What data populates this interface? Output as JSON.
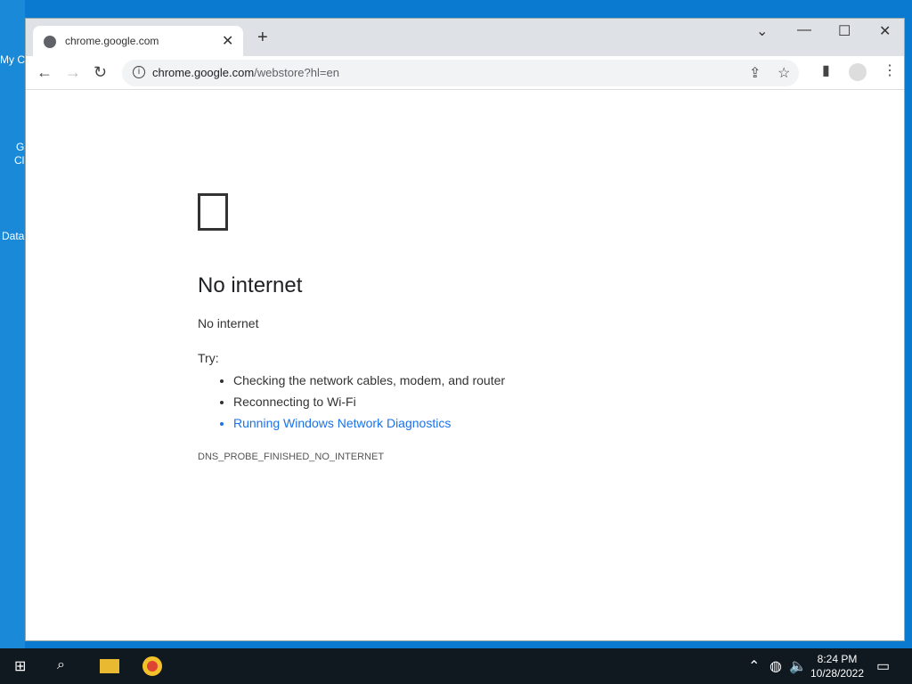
{
  "desktop": {
    "labels": [
      "My C",
      "G",
      "Cl",
      "Data"
    ]
  },
  "browser": {
    "tab_title": "chrome.google.com",
    "url_host": "chrome.google.com",
    "url_path": "/webstore?hl=en"
  },
  "error": {
    "title": "No internet",
    "subtitle": "No internet",
    "try_label": "Try:",
    "suggestions": [
      "Checking the network cables, modem, and router",
      "Reconnecting to Wi-Fi"
    ],
    "link": "Running Windows Network Diagnostics",
    "code": "DNS_PROBE_FINISHED_NO_INTERNET"
  },
  "taskbar": {
    "time": "8:24 PM",
    "date": "10/28/2022"
  },
  "icons": [
    "windows-start-icon",
    "search-icon",
    "file-explorer-icon",
    "chrome-icon",
    "chevron-up-icon",
    "globe-icon",
    "volume-icon",
    "notifications-icon"
  ]
}
